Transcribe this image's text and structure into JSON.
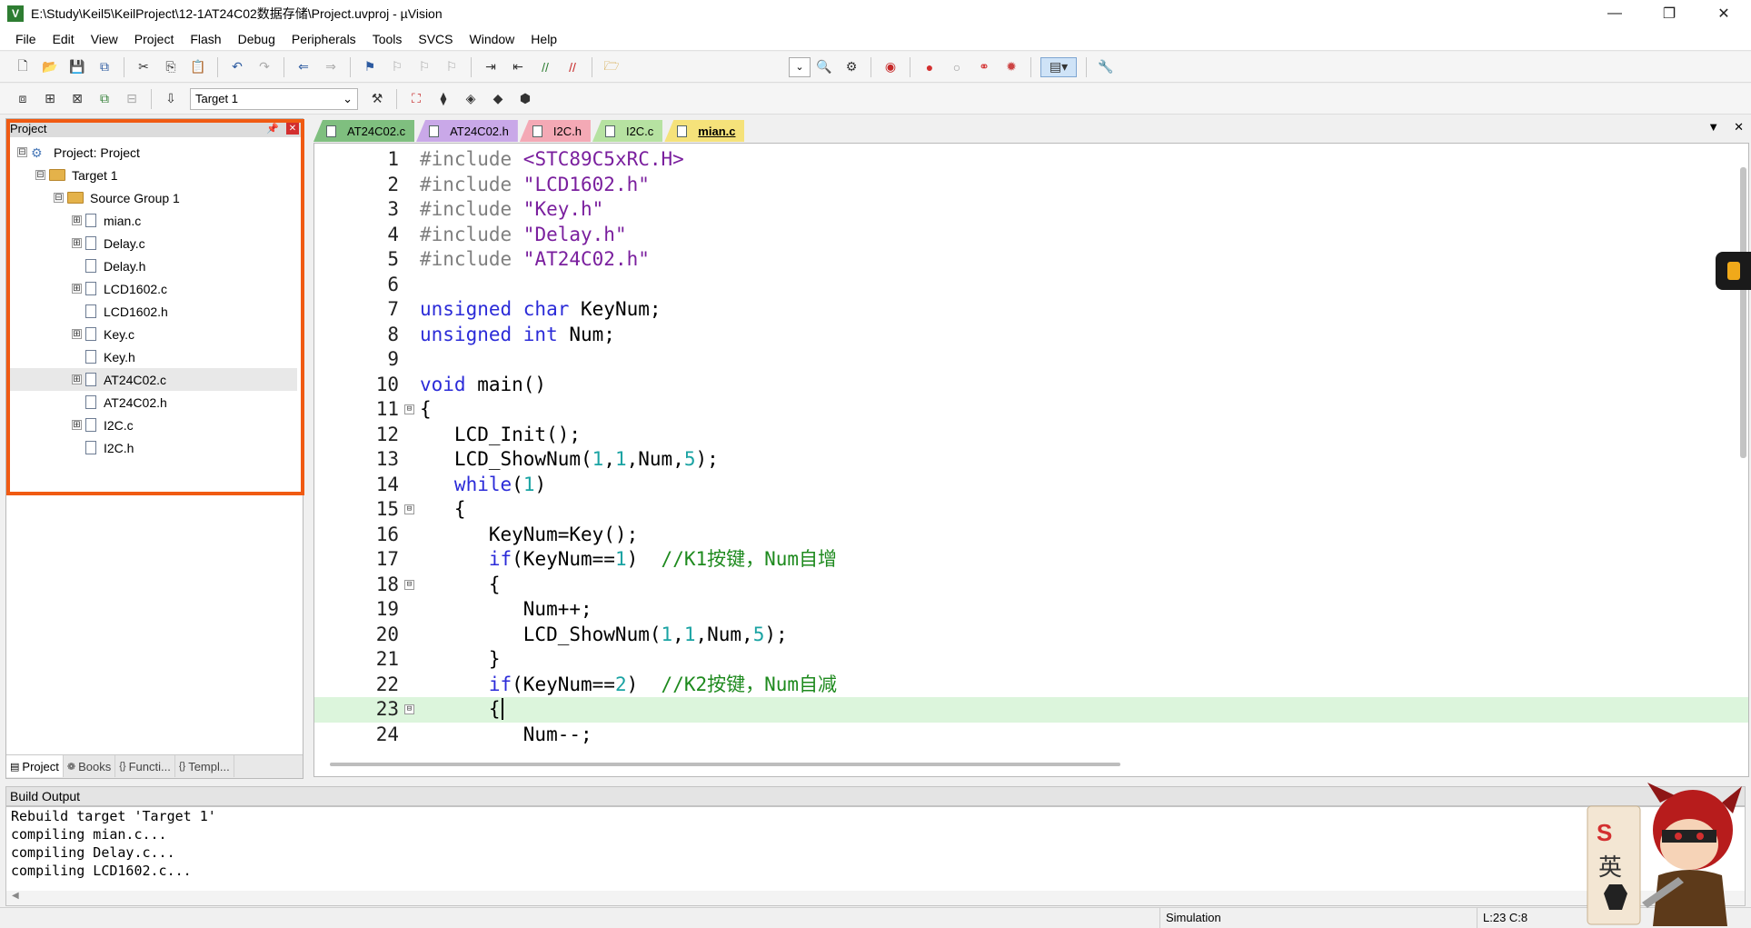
{
  "window": {
    "title": "E:\\Study\\Keil5\\KeilProject\\12-1AT24C02数据存储\\Project.uvproj - µVision",
    "controls": [
      "—",
      "❐",
      "✕"
    ]
  },
  "menu": [
    "File",
    "Edit",
    "View",
    "Project",
    "Flash",
    "Debug",
    "Peripherals",
    "Tools",
    "SVCS",
    "Window",
    "Help"
  ],
  "toolbar2": {
    "target": "Target 1"
  },
  "project_panel": {
    "title": "Project",
    "tree": [
      {
        "label": "Project: Project",
        "level": 0,
        "type": "project",
        "exp": "⊟"
      },
      {
        "label": "Target 1",
        "level": 1,
        "type": "folder",
        "exp": "⊟"
      },
      {
        "label": "Source Group 1",
        "level": 2,
        "type": "folder",
        "exp": "⊟"
      },
      {
        "label": "mian.c",
        "level": 3,
        "type": "file",
        "exp": "⊞"
      },
      {
        "label": "Delay.c",
        "level": 3,
        "type": "file",
        "exp": "⊞"
      },
      {
        "label": "Delay.h",
        "level": 3,
        "type": "file",
        "exp": ""
      },
      {
        "label": "LCD1602.c",
        "level": 3,
        "type": "file",
        "exp": "⊞"
      },
      {
        "label": "LCD1602.h",
        "level": 3,
        "type": "file",
        "exp": ""
      },
      {
        "label": "Key.c",
        "level": 3,
        "type": "file",
        "exp": "⊞"
      },
      {
        "label": "Key.h",
        "level": 3,
        "type": "file",
        "exp": ""
      },
      {
        "label": "AT24C02.c",
        "level": 3,
        "type": "file",
        "exp": "⊞",
        "selected": true
      },
      {
        "label": "AT24C02.h",
        "level": 3,
        "type": "file",
        "exp": ""
      },
      {
        "label": "I2C.c",
        "level": 3,
        "type": "file",
        "exp": "⊞"
      },
      {
        "label": "I2C.h",
        "level": 3,
        "type": "file",
        "exp": ""
      }
    ],
    "tabs": [
      {
        "label": "Project",
        "icon": "▤"
      },
      {
        "label": "Books",
        "icon": "❁"
      },
      {
        "label": "Functi...",
        "icon": "{}"
      },
      {
        "label": "Templ...",
        "icon": "{}"
      }
    ]
  },
  "editor_tabs": [
    {
      "label": "AT24C02.c",
      "color": "#7fbf7f"
    },
    {
      "label": "AT24C02.h",
      "color": "#c9a8e8"
    },
    {
      "label": "I2C.h",
      "color": "#f4a9b5"
    },
    {
      "label": "I2C.c",
      "color": "#b6e2a1"
    },
    {
      "label": "mian.c",
      "color": "#f5e27a",
      "active": true
    }
  ],
  "code_lines": [
    {
      "n": "1",
      "parts": [
        [
          "pp",
          "#include "
        ],
        [
          "str",
          "<STC89C5xRC.H>"
        ]
      ]
    },
    {
      "n": "2",
      "parts": [
        [
          "pp",
          "#include "
        ],
        [
          "str",
          "\"LCD1602.h\""
        ]
      ]
    },
    {
      "n": "3",
      "parts": [
        [
          "pp",
          "#include "
        ],
        [
          "str",
          "\"Key.h\""
        ]
      ]
    },
    {
      "n": "4",
      "parts": [
        [
          "pp",
          "#include "
        ],
        [
          "str",
          "\"Delay.h\""
        ]
      ]
    },
    {
      "n": "5",
      "parts": [
        [
          "pp",
          "#include "
        ],
        [
          "str",
          "\"AT24C02.h\""
        ]
      ]
    },
    {
      "n": "6",
      "parts": []
    },
    {
      "n": "7",
      "parts": [
        [
          "kw",
          "unsigned char"
        ],
        [
          "plain",
          " KeyNum;"
        ]
      ]
    },
    {
      "n": "8",
      "parts": [
        [
          "kw",
          "unsigned int"
        ],
        [
          "plain",
          " Num;"
        ]
      ]
    },
    {
      "n": "9",
      "parts": []
    },
    {
      "n": "10",
      "parts": [
        [
          "kw",
          "void"
        ],
        [
          "plain",
          " main()"
        ]
      ]
    },
    {
      "n": "11",
      "fold": "⊟",
      "parts": [
        [
          "plain",
          "{"
        ]
      ]
    },
    {
      "n": "12",
      "parts": [
        [
          "plain",
          "   LCD_Init();"
        ]
      ]
    },
    {
      "n": "13",
      "parts": [
        [
          "plain",
          "   LCD_ShowNum("
        ],
        [
          "num",
          "1"
        ],
        [
          "plain",
          ","
        ],
        [
          "num",
          "1"
        ],
        [
          "plain",
          ",Num,"
        ],
        [
          "num",
          "5"
        ],
        [
          "plain",
          ");"
        ]
      ]
    },
    {
      "n": "14",
      "parts": [
        [
          "kw",
          "   while"
        ],
        [
          "plain",
          "("
        ],
        [
          "num",
          "1"
        ],
        [
          "plain",
          ")"
        ]
      ]
    },
    {
      "n": "15",
      "fold": "⊟",
      "parts": [
        [
          "plain",
          "   {"
        ]
      ]
    },
    {
      "n": "16",
      "parts": [
        [
          "plain",
          "      KeyNum=Key();"
        ]
      ]
    },
    {
      "n": "17",
      "parts": [
        [
          "kw",
          "      if"
        ],
        [
          "plain",
          "(KeyNum=="
        ],
        [
          "num",
          "1"
        ],
        [
          "plain",
          ")  "
        ],
        [
          "cm",
          "//K1按键，Num自增"
        ]
      ]
    },
    {
      "n": "18",
      "fold": "⊟",
      "parts": [
        [
          "plain",
          "      {"
        ]
      ]
    },
    {
      "n": "19",
      "parts": [
        [
          "plain",
          "         Num++;"
        ]
      ]
    },
    {
      "n": "20",
      "parts": [
        [
          "plain",
          "         LCD_ShowNum("
        ],
        [
          "num",
          "1"
        ],
        [
          "plain",
          ","
        ],
        [
          "num",
          "1"
        ],
        [
          "plain",
          ",Num,"
        ],
        [
          "num",
          "5"
        ],
        [
          "plain",
          ");"
        ]
      ]
    },
    {
      "n": "21",
      "parts": [
        [
          "plain",
          "      }"
        ]
      ]
    },
    {
      "n": "22",
      "parts": [
        [
          "kw",
          "      if"
        ],
        [
          "plain",
          "(KeyNum=="
        ],
        [
          "num",
          "2"
        ],
        [
          "plain",
          ")  "
        ],
        [
          "cm",
          "//K2按键，Num自减"
        ]
      ]
    },
    {
      "n": "23",
      "fold": "⊟",
      "current": true,
      "parts": [
        [
          "plain",
          "      {"
        ]
      ]
    },
    {
      "n": "24",
      "parts": [
        [
          "plain",
          "         Num--;"
        ]
      ]
    }
  ],
  "build_output": {
    "title": "Build Output",
    "lines": [
      "Rebuild target 'Target 1'",
      "compiling mian.c...",
      "compiling Delay.c...",
      "compiling LCD1602.c..."
    ]
  },
  "status": {
    "mode": "Simulation",
    "position": "L:23 C:8"
  },
  "mascot": {
    "badge": "S",
    "char": "英"
  }
}
